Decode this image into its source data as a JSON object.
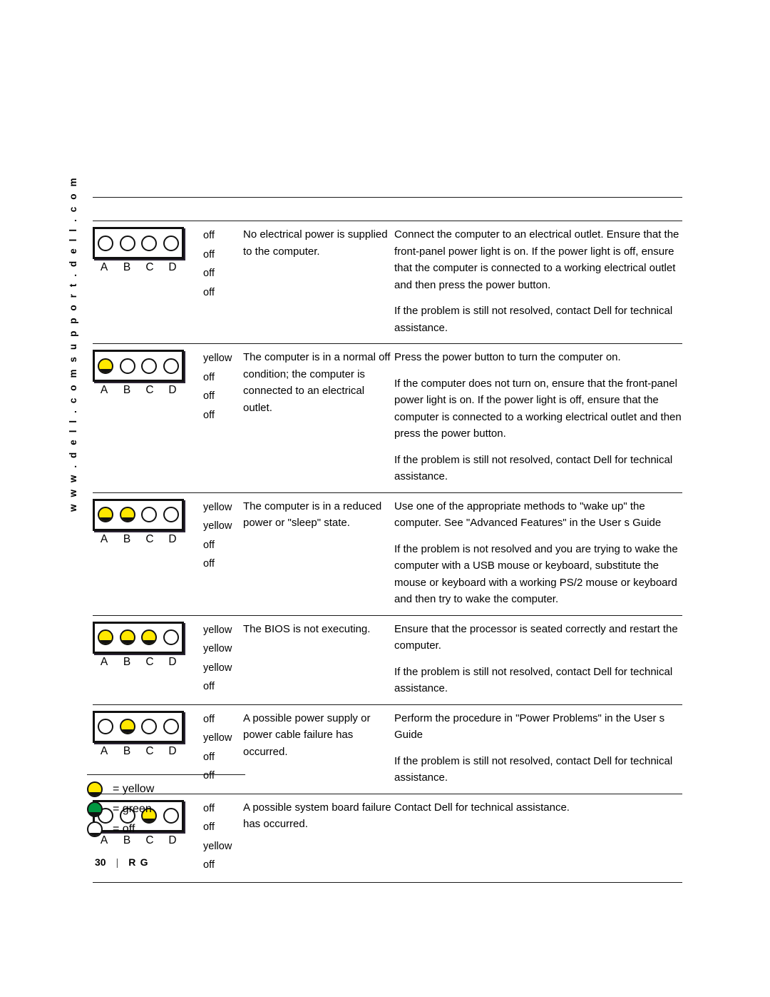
{
  "side_watermark": "w w w . d e l l . c o m      s u p p o r t . d e l l . c o m",
  "legend": {
    "items": [
      {
        "state": "yellow",
        "label": "= yellow"
      },
      {
        "state": "green",
        "label": "= green"
      },
      {
        "state": "off",
        "label": "= off"
      }
    ]
  },
  "footer": {
    "page_number": "30",
    "separator": "|",
    "book": "R G"
  },
  "led_labels": [
    "A",
    "B",
    "C",
    "D"
  ],
  "colors": {
    "yellow": "#FFE800",
    "green": "#009640",
    "off": "#FFFFFF",
    "outline": "#111111"
  },
  "table": {
    "rows": [
      {
        "leds": [
          "off",
          "off",
          "off",
          "off"
        ],
        "status": [
          "off",
          "off",
          "off",
          "off"
        ],
        "description": "No electrical power is supplied to the computer.",
        "actions": [
          "Connect the computer to an electrical outlet. Ensure that the front-panel power light is on. If the power light is off, ensure that the computer is connected to a working electrical outlet and then press the power button.",
          "If the problem is still not resolved, contact Dell for technical assistance."
        ]
      },
      {
        "leds": [
          "yellow",
          "off",
          "off",
          "off"
        ],
        "status": [
          "yellow",
          "off",
          "off",
          "off"
        ],
        "description": "The computer is in a normal off condition; the computer is connected to an electrical outlet.",
        "actions": [
          "Press the power button to turn the computer on.",
          "If the computer does not turn on, ensure that the front-panel power light is on. If the power light is off, ensure that the computer is connected to a working electrical outlet and then press the power button.",
          "If the problem is still not resolved, contact Dell for technical assistance."
        ]
      },
      {
        "leds": [
          "yellow",
          "yellow",
          "off",
          "off"
        ],
        "status": [
          "yellow",
          "yellow",
          "off",
          "off"
        ],
        "description": "The computer is in a reduced power or \"sleep\" state.",
        "actions": [
          "Use one of the appropriate methods to \"wake up\" the computer. See \"Advanced Features\" in the User s Guide",
          "If the problem is not resolved and you are trying to wake the computer with a USB mouse or keyboard, substitute the mouse or keyboard with a working PS/2 mouse or keyboard and then try to wake the computer."
        ]
      },
      {
        "leds": [
          "yellow",
          "yellow",
          "yellow",
          "off"
        ],
        "status": [
          "yellow",
          "yellow",
          "yellow",
          "off"
        ],
        "description": "The BIOS is not executing.",
        "actions": [
          "Ensure that the processor is seated correctly and restart the computer.",
          "If the problem is still not resolved, contact Dell for technical assistance."
        ]
      },
      {
        "leds": [
          "off",
          "yellow",
          "off",
          "off"
        ],
        "status": [
          "off",
          "yellow",
          "off",
          "off"
        ],
        "description": "A possible power supply or power cable failure has occurred.",
        "actions": [
          "Perform the procedure in \"Power Problems\" in the User s Guide",
          "If the problem is still not resolved, contact Dell for technical assistance."
        ]
      },
      {
        "leds": [
          "off",
          "off",
          "yellow",
          "off"
        ],
        "status": [
          "off",
          "off",
          "yellow",
          "off"
        ],
        "description": "A possible system board failure has occurred.",
        "actions": [
          "Contact Dell for technical assistance."
        ]
      }
    ]
  }
}
